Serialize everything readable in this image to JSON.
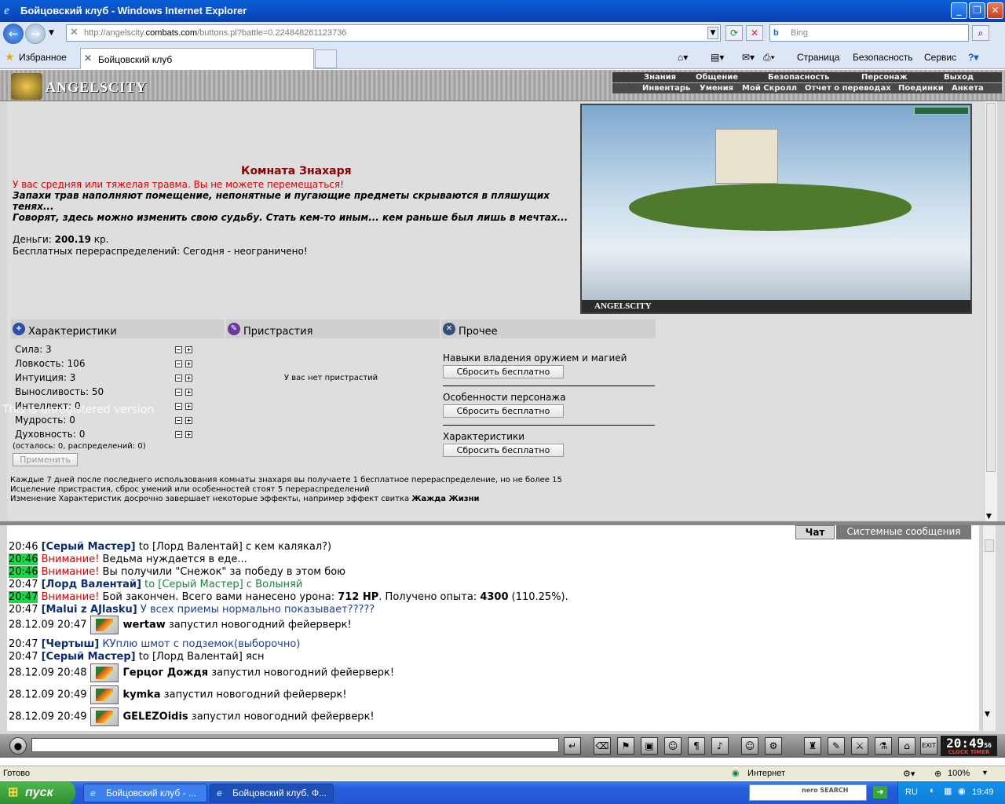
{
  "window": {
    "title": "Бойцовский клуб - Windows Internet Explorer"
  },
  "browser": {
    "url_prefix": "http://angelscity.",
    "url_domain": "combats.com",
    "url_rest": "/buttons.pl?battle=0.224848261123736",
    "search_placeholder": "Bing",
    "favorites": "Избранное",
    "tab_title": "Бойцовский клуб",
    "commands": [
      "Страница",
      "Безопасность",
      "Сервис"
    ]
  },
  "game": {
    "logo": "ANGELSCITY",
    "menu_top": [
      "Знания",
      "Общение",
      "Безопасность",
      "Персонаж",
      "Выход"
    ],
    "menu_bottom": [
      "Инвентарь",
      "Умения",
      "Мой Скролл",
      "Отчет о переводах",
      "Поединки",
      "Анкета"
    ],
    "room_title": "Комната Знахаря",
    "injury": "У вас средняя или тяжелая травма. Вы не можете перемещаться!",
    "desc1": "Запахи трав наполняют помещение, непонятные и пугающие предметы скрываются в пляшущих тенях...",
    "desc2": "Говорят, здесь можно изменить свою судьбу. Стать кем-то иным... кем раньше был лишь в мечтах...",
    "money_label": "Деньги:",
    "money_value": "200.19",
    "money_unit": "кр.",
    "free_redistrib": "Бесплатных перераспределений: Сегодня - неограничено!",
    "picture_caption": "ANGELSCITY",
    "watermark": "This is unregistered version",
    "sections": {
      "stats": "Характеристики",
      "addictions": "Пристрастия",
      "other": "Прочее"
    },
    "stats": [
      "Сила: 3",
      "Ловкость: 106",
      "Интуиция: 3",
      "Выносливость: 50",
      "Интеллект: 0",
      "Мудрость: 0",
      "Духовность: 0"
    ],
    "stats_remaining": "(осталось: 0, распределений: 0)",
    "apply_button": "Применить",
    "no_addictions": "У вас нет пристрастий",
    "other_items": [
      {
        "label": "Навыки владения оружием и магией",
        "button": "Сбросить бесплатно"
      },
      {
        "label": "Особенности персонажа",
        "button": "Сбросить бесплатно"
      },
      {
        "label": "Характеристики",
        "button": "Сбросить бесплатно"
      }
    ],
    "notes": [
      "Каждые 7 дней после последнего использования комнаты знахаря вы получаете 1 бесплатное перераспределение, но не более 15",
      "Исцеление пристрастия, сброс умений или особенностей стоят 5 перераспределений",
      "Изменение Характеристик досрочно завершает некоторые эффекты, например эффект свитка"
    ],
    "note_bold": "Жажда Жизни"
  },
  "chat": {
    "tabs": [
      "Чат",
      "Системные сообщения"
    ],
    "lines": [
      {
        "time": "20:46",
        "nick": "[Серый Мастер]",
        "mid": " to [Лорд Валентай] ",
        "text": "с кем калякал?)"
      },
      {
        "time": "20:46",
        "warn": "Внимание!",
        "text": " Ведьма нуждается в еде..."
      },
      {
        "time": "20:46",
        "warn": "Внимание!",
        "text": " Вы получили \"Снежок\" за победу в этом бою"
      },
      {
        "time": "20:47",
        "nick": "[Лорд Валентай]",
        "mid": " to [Серый Мастер] ",
        "text": "с Волыняй"
      },
      {
        "time": "20:47",
        "warn": "Внимание!",
        "text_a": " Бой закончен. Всего вами нанесено урона: ",
        "dmg": "712 HP",
        "text_b": ". Получено опыта: ",
        "exp": "4300",
        "text_c": " (110.25%)."
      },
      {
        "time": "20:47",
        "nick": "[Malui z AJlasku]",
        "text": " У всех приемы нормально показывает?????"
      },
      {
        "time": "28.12.09 20:47",
        "who": "wertaw",
        "text": " запустил новогодний фейерверк!"
      },
      {
        "time": "20:47",
        "nick": "[Чертыш]",
        "text": " КУплю шмот с подземок(выборочно)"
      },
      {
        "time": "20:47",
        "nick": "[Серый Мастер]",
        "mid": " to [Лорд Валентай] ",
        "text": "ясн"
      },
      {
        "time": "28.12.09 20:48",
        "who": "Герцог Дождя",
        "text": " запустил новогодний фейерверк!"
      },
      {
        "time": "28.12.09 20:49",
        "who": "kymka",
        "text": " запустил новогодний фейерверк!"
      },
      {
        "time": "28.12.09 20:49",
        "who": "GELEZOidis",
        "text": " запустил новогодний фейерверк!"
      }
    ],
    "clock": "20:49",
    "clock_sec": "56",
    "clock_label": "CLOCK TIMER"
  },
  "statusbar": {
    "left": "Готово",
    "zone": "Интернет",
    "zoom": "100%"
  },
  "taskbar": {
    "start": "пуск",
    "tasks": [
      "Бойцовский клуб - ...",
      "Бойцовский клуб. Ф..."
    ],
    "search": "nero SEARCH",
    "lang": "RU",
    "time": "19:49"
  }
}
